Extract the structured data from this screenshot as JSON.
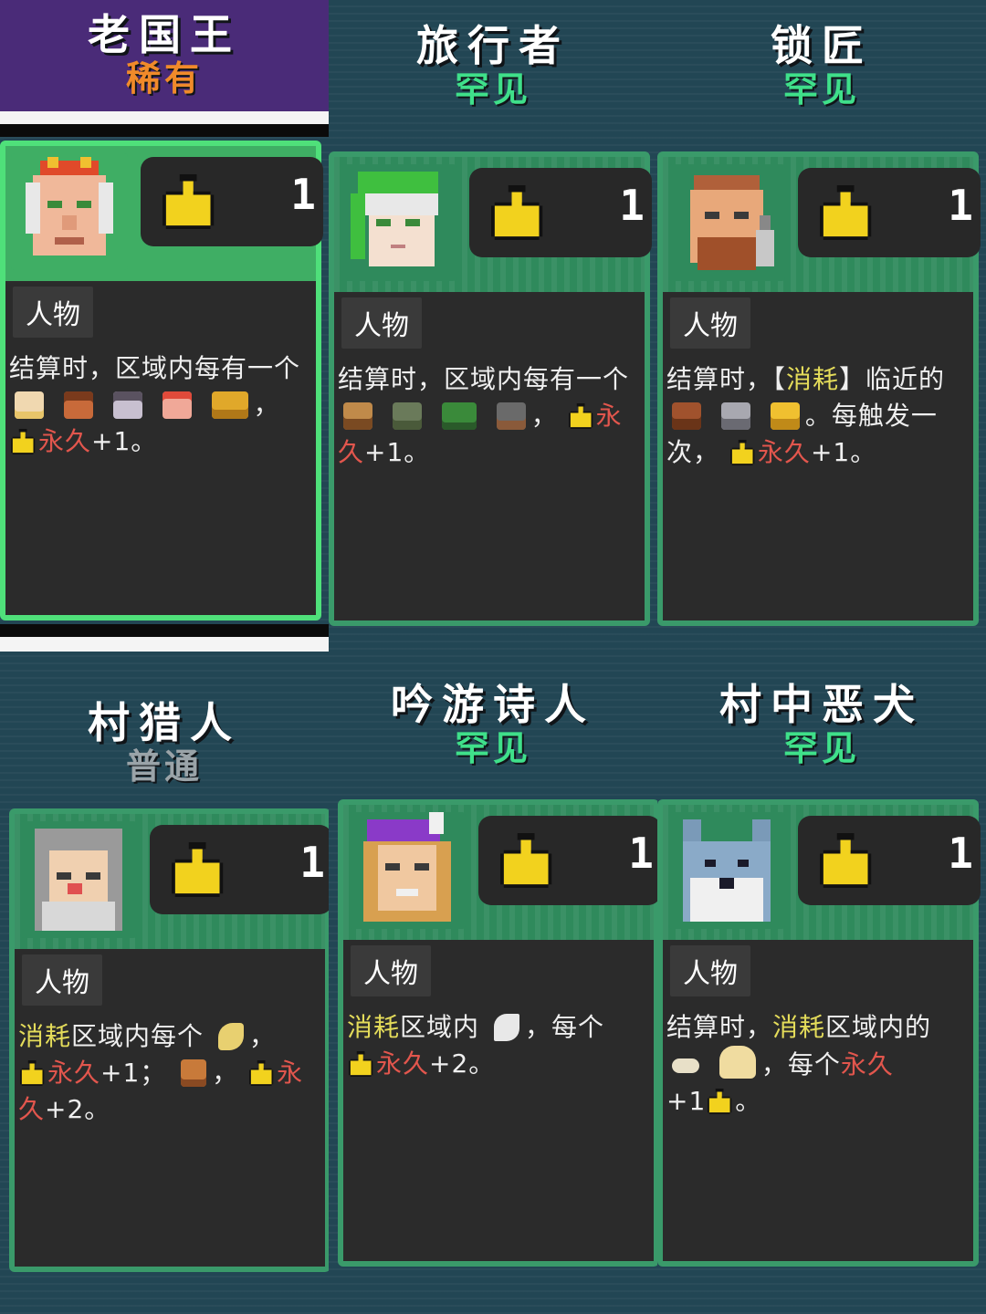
{
  "colors": {
    "rare": "#f08a2a",
    "uncommon": "#3fe08a",
    "common": "#9aa3a8",
    "keyword": "#e4dc5a",
    "permanent": "#e2564d"
  },
  "cards": [
    {
      "name": "老国王",
      "rarity": "稀有",
      "stat": "1",
      "tag": "人物",
      "d1": "结算时，区域内每有一个",
      "d2": "，",
      "d3": "永久",
      "d4": "+1。"
    },
    {
      "name": "旅行者",
      "rarity": "罕见",
      "stat": "1",
      "tag": "人物",
      "d1": "结算时，区域内每有一个",
      "d2": "，",
      "d3": "永久",
      "d4": "+1。"
    },
    {
      "name": "锁匠",
      "rarity": "罕见",
      "stat": "1",
      "tag": "人物",
      "d1": "结算时，",
      "d2": "【",
      "d3": "消耗",
      "d4": "】临近的",
      "d5": "。每触发一次，",
      "d6": "永久",
      "d7": "+1。"
    },
    {
      "name": "村猎人",
      "rarity": "普通",
      "stat": "1",
      "tag": "人物",
      "d1": "消耗",
      "d2": "区域内每个",
      "d3": "，",
      "d4": "永久",
      "d5": "+1；",
      "d6": "，",
      "d7": "永久",
      "d8": "+2。"
    },
    {
      "name": "吟游诗人",
      "rarity": "罕见",
      "stat": "1",
      "tag": "人物",
      "d1": "消耗",
      "d2": "区域内",
      "d3": "，每个",
      "d4": "永久",
      "d5": "+2。"
    },
    {
      "name": "村中恶犬",
      "rarity": "罕见",
      "stat": "1",
      "tag": "人物",
      "d1": "结算时，",
      "d2": "消耗",
      "d3": "区域内的",
      "d4": "，每个",
      "d5": "永久",
      "d6": "+1",
      "d7": "。"
    }
  ],
  "icons": [
    "thumbs-up-icon",
    "princess-icon",
    "girl-icon",
    "old-woman-icon",
    "santa-icon",
    "gold-bar-icon",
    "house-icon",
    "tent-icon",
    "forest-icon",
    "well-icon",
    "wooden-chest-icon",
    "silver-chest-icon",
    "gold-chest-icon",
    "banana-icon",
    "meat-icon",
    "feather-icon",
    "bone-icon",
    "bun-icon"
  ]
}
